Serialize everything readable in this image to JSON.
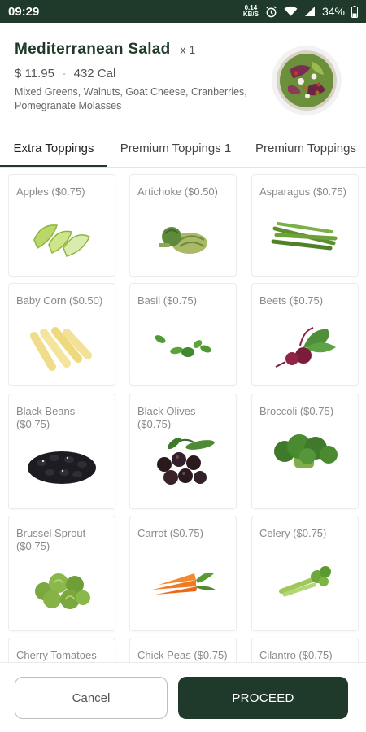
{
  "status_bar": {
    "time": "09:29",
    "net_speed_value": "0.14",
    "net_speed_unit": "KB/S",
    "battery": "34%"
  },
  "product": {
    "title": "Mediterranean Salad",
    "quantity": "x 1",
    "price": "$ 11.95",
    "separator": "-",
    "calories": "432 Cal",
    "description": "Mixed Greens, Walnuts, Goat Cheese, Cranberries, Pomegranate Molasses"
  },
  "tabs": [
    {
      "label": "Extra Toppings",
      "active": true
    },
    {
      "label": "Premium Toppings 1",
      "active": false
    },
    {
      "label": "Premium Toppings",
      "active": false
    }
  ],
  "toppings": [
    {
      "label": "Apples ($0.75)",
      "icon": "apple-slices-icon"
    },
    {
      "label": "Artichoke ($0.50)",
      "icon": "artichoke-icon"
    },
    {
      "label": "Asparagus ($0.75)",
      "icon": "asparagus-icon"
    },
    {
      "label": "Baby Corn ($0.50)",
      "icon": "baby-corn-icon"
    },
    {
      "label": "Basil ($0.75)",
      "icon": "basil-icon"
    },
    {
      "label": "Beets ($0.75)",
      "icon": "beets-icon"
    },
    {
      "label": "Black Beans ($0.75)",
      "icon": "black-beans-icon"
    },
    {
      "label": "Black Olives ($0.75)",
      "icon": "black-olives-icon"
    },
    {
      "label": "Broccoli ($0.75)",
      "icon": "broccoli-icon"
    },
    {
      "label": "Brussel Sprout ($0.75)",
      "icon": "brussel-sprout-icon"
    },
    {
      "label": "Carrot ($0.75)",
      "icon": "carrot-icon"
    },
    {
      "label": "Celery ($0.75)",
      "icon": "celery-icon"
    },
    {
      "label": "Cherry Tomatoes",
      "icon": "cherry-tomato-icon"
    },
    {
      "label": "Chick Peas ($0.75)",
      "icon": "chick-peas-icon"
    },
    {
      "label": "Cilantro ($0.75)",
      "icon": "cilantro-icon"
    }
  ],
  "footer": {
    "cancel_label": "Cancel",
    "proceed_label": "PROCEED"
  },
  "colors": {
    "brand": "#1f3a2a",
    "card_border": "#ececec"
  }
}
